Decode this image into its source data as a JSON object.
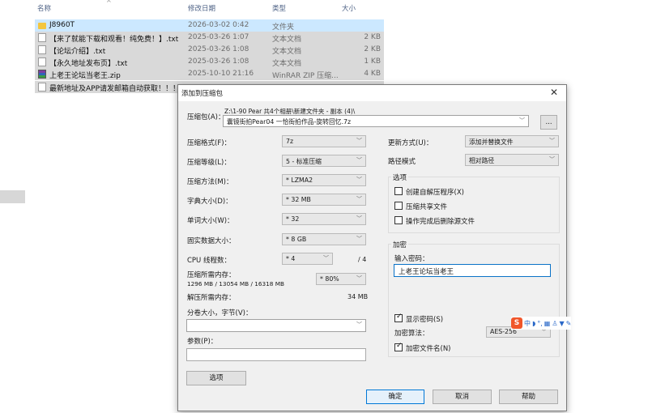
{
  "explorer": {
    "headers": {
      "name": "名称",
      "date": "修改日期",
      "type": "类型",
      "size": "大小"
    },
    "rows": [
      {
        "name": "J8960T",
        "date": "2026-03-02 0:42",
        "type": "文件夹",
        "size": "",
        "icon": "folder-icon"
      },
      {
        "name": "【来了就能下载和观看！纯免费！】.txt",
        "date": "2025-03-26 1:07",
        "type": "文本文档",
        "size": "2 KB",
        "icon": "text-file-icon"
      },
      {
        "name": "【论坛介绍】.txt",
        "date": "2025-03-26 1:08",
        "type": "文本文档",
        "size": "2 KB",
        "icon": "text-file-icon"
      },
      {
        "name": "【永久地址发布页】.txt",
        "date": "2025-03-26 1:08",
        "type": "文本文档",
        "size": "1 KB",
        "icon": "text-file-icon"
      },
      {
        "name": "上老王论坛当老王.zip",
        "date": "2025-10-10 21:16",
        "type": "WinRAR ZIP 压缩...",
        "size": "4 KB",
        "icon": "winrar-zip-icon"
      },
      {
        "name": "最新地址及APP请发邮箱自动获取！！！...",
        "date": "",
        "type": "",
        "size": "",
        "icon": "text-file-icon"
      }
    ]
  },
  "dialog": {
    "title": "添加到压缩包",
    "archive_label": "压缩包(A)：",
    "archive_path": "Z:\\1-90 Pear   共4个相册\\新建文件夹 - 副本 (4)\\",
    "archive_name": "囊镜街拍Pear04 一恰街拍作品-旋转回忆.7z",
    "browse_label": "...",
    "format_label": "压缩格式(F)：",
    "format_value": "7z",
    "level_label": "压缩等级(L)：",
    "level_value": "5 - 标准压缩",
    "method_label": "压缩方法(M)：",
    "method_value": "* LZMA2",
    "dict_label": "字典大小(D)：",
    "dict_value": "* 32 MB",
    "word_label": "单词大小(W)：",
    "word_value": "* 32",
    "solid_label": "固实数据大小：",
    "solid_value": "* 8 GB",
    "cpu_label": "CPU 线程数：",
    "cpu_value": "* 4",
    "cpu_total": "/ 4",
    "mem_label": "压缩所需内存：",
    "mem_detail": "1296 MB / 13054 MB / 16318 MB",
    "mem_percent": "* 80%",
    "decomp_label": "解压所需内存：",
    "decomp_value": "34 MB",
    "split_label": "分卷大小，字节(V)：",
    "params_label": "参数(P)：",
    "options_button": "选项",
    "update_label": "更新方式(U)：",
    "update_value": "添加并替换文件",
    "path_mode_label": "路径模式",
    "path_mode_value": "相对路径",
    "options_group": "选项",
    "opt_sfx": "创建自解压程序(X)",
    "opt_shared": "压缩共享文件",
    "opt_delete": "操作完成后删除源文件",
    "enc_group": "加密",
    "pwd_label": "输入密码：",
    "pwd_value": "上老王论坛当老王",
    "show_pwd": "显示密码(S)",
    "enc_method_label": "加密算法：",
    "enc_method_value": "AES-256",
    "enc_names": "加密文件名(N)",
    "ok": "确定",
    "cancel": "取消",
    "help": "帮助"
  },
  "ime": {
    "logo": "S",
    "mode": "中"
  }
}
